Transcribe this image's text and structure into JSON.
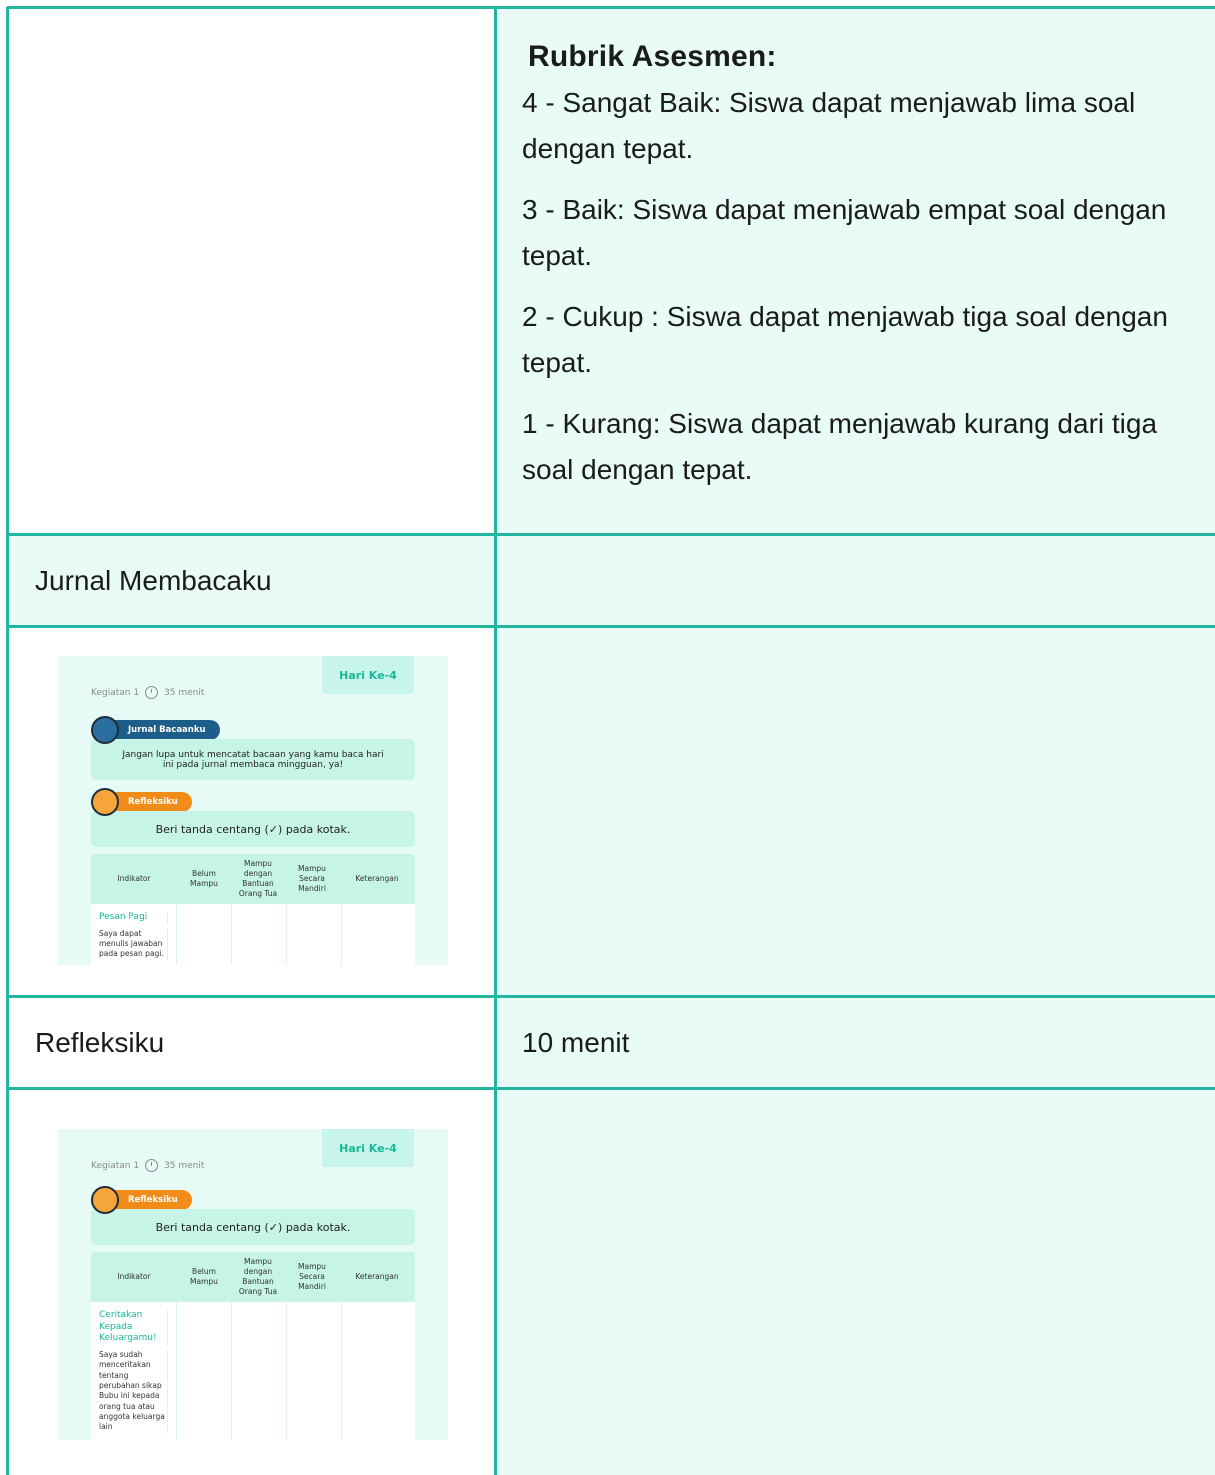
{
  "rubrik": {
    "title": "Rubrik Asesmen:",
    "items": [
      "4 - Sangat Baik: Siswa dapat menjawab lima soal dengan tepat.",
      "3 - Baik: Siswa dapat menjawab empat soal dengan tepat.",
      "2 - Cukup : Siswa dapat menjawab tiga  soal dengan tepat.",
      "1 - Kurang: Siswa dapat menjawab kurang dari tiga soal dengan tepat."
    ]
  },
  "rows": {
    "jurnal_label": "Jurnal Membacaku",
    "refleksi_label": "Refleksiku",
    "refleksi_duration": "10 menit"
  },
  "card1": {
    "hari": "Hari Ke-4",
    "kegiatan": "Kegiatan 1",
    "durasi": "35 menit",
    "pill1": "Jurnal Bacaanku",
    "note": "Jangan lupa untuk mencatat bacaan yang kamu baca hari ini pada jurnal membaca mingguan, ya!",
    "pill2": "Refleksiku",
    "instruction": "Beri tanda centang (✓) pada kotak.",
    "headers": [
      "Indikator",
      "Belum Mampu",
      "Mampu dengan Bantuan Orang Tua",
      "Mampu Secara Mandiri",
      "Keterangan"
    ],
    "indicator_title": "Pesan Pagi",
    "indicator_desc": "Saya dapat menulis jawaban pada pesan pagi."
  },
  "card2": {
    "hari": "Hari Ke-4",
    "kegiatan": "Kegiatan 1",
    "durasi": "35 menit",
    "pill": "Refleksiku",
    "instruction": "Beri tanda centang (✓) pada kotak.",
    "headers": [
      "Indikator",
      "Belum Mampu",
      "Mampu dengan Bantuan Orang Tua",
      "Mampu Secara Mandiri",
      "Keterangan"
    ],
    "indicator_title": "Ceritakan Kepada Keluargamu!",
    "indicator_desc": "Saya sudah menceritakan tentang perubahan sikap Bubu ini kepada orang tua atau anggota keluarga lain"
  },
  "colors": {
    "border": "#22b6a0",
    "tint": "#e8fbf6",
    "accent": "#17b79b",
    "blue_pill": "#1d5d8a",
    "orange_pill": "#f28c18"
  },
  "icons": [
    "clock-icon",
    "journal-badge-icon",
    "reflection-badge-icon"
  ]
}
